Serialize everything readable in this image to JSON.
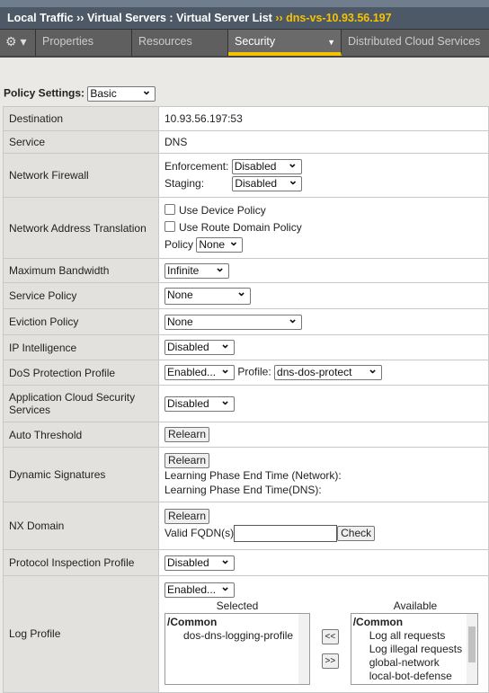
{
  "breadcrumb": {
    "items": [
      "Local Traffic",
      "Virtual Servers : Virtual Server List"
    ],
    "current": "dns-vs-10.93.56.197",
    "separator": "››"
  },
  "tabs": [
    {
      "label": "Properties"
    },
    {
      "label": "Resources"
    },
    {
      "label": "Security",
      "active": true
    },
    {
      "label": "Distributed Cloud Services"
    }
  ],
  "policy_settings": {
    "label": "Policy Settings:",
    "value": "Basic"
  },
  "rows": {
    "destination": {
      "label": "Destination",
      "value": "10.93.56.197:53"
    },
    "service": {
      "label": "Service",
      "value": "DNS"
    },
    "firewall": {
      "label": "Network Firewall",
      "enf_label": "Enforcement:",
      "enf": "Disabled",
      "stg_label": "Staging:",
      "stg": "Disabled"
    },
    "nat": {
      "label": "Network Address Translation",
      "cb1": "Use Device Policy",
      "cb2": "Use Route Domain Policy",
      "policy_label": "Policy",
      "policy": "None"
    },
    "bandwidth": {
      "label": "Maximum Bandwidth",
      "value": "Infinite"
    },
    "service_policy": {
      "label": "Service Policy",
      "value": "None"
    },
    "eviction": {
      "label": "Eviction Policy",
      "value": "None"
    },
    "ip_intel": {
      "label": "IP Intelligence",
      "value": "Disabled"
    },
    "dos": {
      "label": "DoS Protection Profile",
      "value": "Enabled...",
      "profile_label": "Profile:",
      "profile": "dns-dos-protect"
    },
    "acss": {
      "label": "Application Cloud Security Services",
      "value": "Disabled"
    },
    "auto": {
      "label": "Auto Threshold",
      "button": "Relearn"
    },
    "dynsig": {
      "label": "Dynamic Signatures",
      "button": "Relearn",
      "t1": "Learning Phase End Time (Network):",
      "t2": "Learning Phase End Time(DNS):"
    },
    "nx": {
      "label": "NX Domain",
      "button": "Relearn",
      "fqdn_label": "Valid FQDN(s)",
      "fqdn_value": "",
      "check": "Check"
    },
    "pip": {
      "label": "Protocol Inspection Profile",
      "value": "Disabled"
    },
    "log": {
      "label": "Log Profile",
      "value": "Enabled...",
      "selected_label": "Selected",
      "available_label": "Available",
      "selected": [
        "/Common",
        "dos-dns-logging-profile"
      ],
      "available": [
        "/Common",
        "Log all requests",
        "Log illegal requests",
        "global-network",
        "local-bot-defense"
      ],
      "add": "<<",
      "remove": ">>"
    }
  }
}
